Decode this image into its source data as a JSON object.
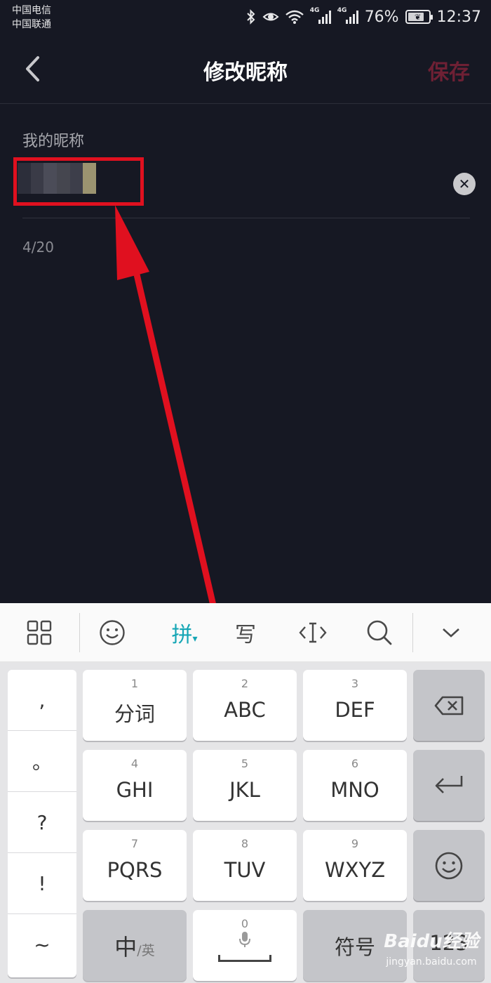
{
  "status_bar": {
    "carrier1": "中国电信",
    "carrier2": "中国联通",
    "net1": "4G",
    "net2": "4G",
    "battery": "76%",
    "time": "12:37"
  },
  "header": {
    "title": "修改昵称",
    "save_label": "保存"
  },
  "form": {
    "label": "我的昵称",
    "counter": "4/20"
  },
  "keyboard": {
    "toolbar": {
      "pinyin_label": "拼",
      "write_label": "写"
    },
    "punctuation": [
      ",",
      "。",
      "?",
      "!",
      "~"
    ],
    "keys": [
      {
        "num": "1",
        "label": "分词"
      },
      {
        "num": "2",
        "label": "ABC"
      },
      {
        "num": "3",
        "label": "DEF"
      },
      {
        "num": "4",
        "label": "GHI"
      },
      {
        "num": "5",
        "label": "JKL"
      },
      {
        "num": "6",
        "label": "MNO"
      },
      {
        "num": "7",
        "label": "PQRS"
      },
      {
        "num": "8",
        "label": "TUV"
      },
      {
        "num": "9",
        "label": "WXYZ"
      }
    ],
    "bottom": {
      "lang_main": "中",
      "lang_sub": "/英",
      "space_num": "0",
      "symbols": "符号",
      "numbers": "123"
    }
  },
  "watermark": {
    "logo": "Baidu经验",
    "url": "jingyan.baidu.com"
  },
  "colors": {
    "background": "#161823",
    "save_accent": "#6e2034",
    "annotation": "#e0101f",
    "pinyin_accent": "#15a6b5"
  }
}
